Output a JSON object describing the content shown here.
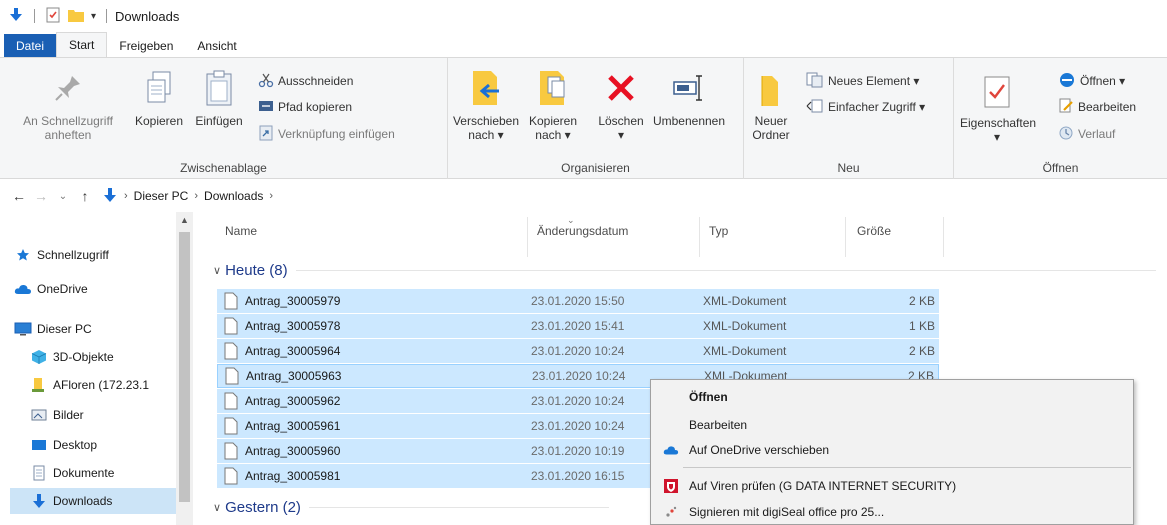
{
  "window": {
    "title": "Downloads"
  },
  "tabs": [
    {
      "label": "Datei"
    },
    {
      "label": "Start"
    },
    {
      "label": "Freigeben"
    },
    {
      "label": "Ansicht"
    }
  ],
  "ribbon": {
    "clipboard": {
      "label": "Zwischenablage",
      "pin_line1": "An Schnellzugriff",
      "pin_line2": "anheften",
      "copy": "Kopieren",
      "paste": "Einfügen",
      "cut": "Ausschneiden",
      "copy_path": "Pfad kopieren",
      "paste_shortcut": "Verknüpfung einfügen"
    },
    "organize": {
      "label": "Organisieren",
      "move_line1": "Verschieben",
      "move_line2": "nach ▾",
      "copy_line1": "Kopieren",
      "copy_line2": "nach ▾",
      "delete": "Löschen",
      "delete_arrow": "▾",
      "rename": "Umbenennen"
    },
    "new": {
      "label": "Neu",
      "folder_line1": "Neuer",
      "folder_line2": "Ordner",
      "new_item": "Neues Element ▾",
      "easy_access": "Einfacher Zugriff ▾"
    },
    "open": {
      "label": "Öffnen",
      "properties": "Eigenschaften",
      "properties_arrow": "▾",
      "open": "Öffnen ▾",
      "edit": "Bearbeiten",
      "history": "Verlauf"
    }
  },
  "address": {
    "crumbs": [
      "Dieser PC",
      "Downloads"
    ]
  },
  "nav": {
    "items": [
      {
        "label": "Schnellzugriff"
      },
      {
        "label": "OneDrive"
      },
      {
        "label": "Dieser PC"
      },
      {
        "label": "3D-Objekte"
      },
      {
        "label": "AFloren (172.23.1"
      },
      {
        "label": "Bilder"
      },
      {
        "label": "Desktop"
      },
      {
        "label": "Dokumente"
      },
      {
        "label": "Downloads"
      }
    ]
  },
  "columns": {
    "name": "Name",
    "date": "Änderungsdatum",
    "type": "Typ",
    "size": "Größe"
  },
  "groups": {
    "today": "Heute (8)",
    "yesterday": "Gestern (2)"
  },
  "files": [
    {
      "name": "Antrag_30005979",
      "date": "23.01.2020 15:50",
      "type": "XML-Dokument",
      "size": "2 KB"
    },
    {
      "name": "Antrag_30005978",
      "date": "23.01.2020 15:41",
      "type": "XML-Dokument",
      "size": "1 KB"
    },
    {
      "name": "Antrag_30005964",
      "date": "23.01.2020 10:24",
      "type": "XML-Dokument",
      "size": "2 KB"
    },
    {
      "name": "Antrag_30005963",
      "date": "23.01.2020 10:24",
      "type": "XML-Dokument",
      "size": "2 KB"
    },
    {
      "name": "Antrag_30005962",
      "date": "23.01.2020 10:24",
      "type": "",
      "size": ""
    },
    {
      "name": "Antrag_30005961",
      "date": "23.01.2020 10:24",
      "type": "",
      "size": ""
    },
    {
      "name": "Antrag_30005960",
      "date": "23.01.2020 10:19",
      "type": "",
      "size": ""
    },
    {
      "name": "Antrag_30005981",
      "date": "23.01.2020 16:15",
      "type": "",
      "size": ""
    }
  ],
  "context_menu": {
    "open": "Öffnen",
    "edit": "Bearbeiten",
    "onedrive": "Auf OneDrive verschieben",
    "virus": "Auf Viren prüfen (G DATA INTERNET SECURITY)",
    "sign": "Signieren mit digiSeal office pro 25..."
  },
  "colors": {
    "accent": "#1a5fb4",
    "selection": "#cce8ff",
    "nav_selected": "#cce4f7",
    "group_header": "#1e3a8a",
    "delete_red": "#e81123",
    "folder_yellow": "#f8c940"
  }
}
